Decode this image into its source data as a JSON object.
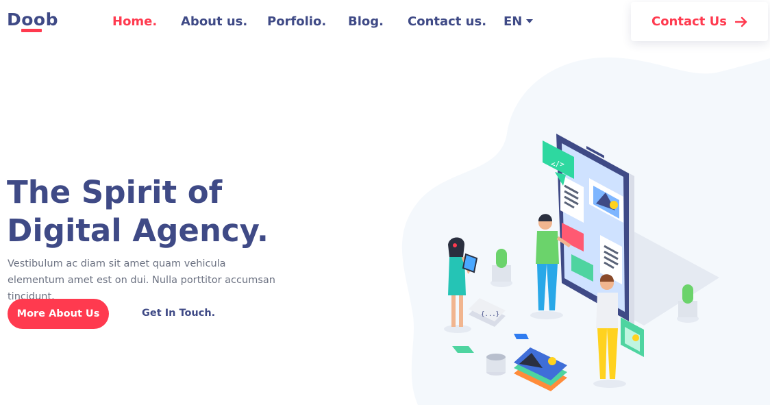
{
  "brand": {
    "logo_text": "Doob"
  },
  "nav": {
    "items": [
      {
        "label": "Home.",
        "active": true
      },
      {
        "label": "About us.",
        "active": false
      },
      {
        "label": "Porfolio.",
        "active": false
      },
      {
        "label": "Blog.",
        "active": false
      },
      {
        "label": "Contact us.",
        "active": false
      }
    ],
    "language": "EN"
  },
  "header_cta": {
    "label": "Contact Us",
    "icon": "arrow-right-icon"
  },
  "hero": {
    "title_line1": "The Spirit of",
    "title_line2": "Digital Agency.",
    "description": "Vestibulum ac diam sit amet quam vehicula elementum amet est on dui. Nulla porttitor accumsan tincidunt.",
    "primary_button": "More About Us",
    "secondary_link": "Get In Touch."
  },
  "illustration": {
    "icon": "isometric-app-development-illustration"
  },
  "colors": {
    "accent": "#ff3a4f",
    "primary_text": "#3f4a86",
    "body_text": "#6c7282",
    "blob": "#f4f8fc"
  }
}
